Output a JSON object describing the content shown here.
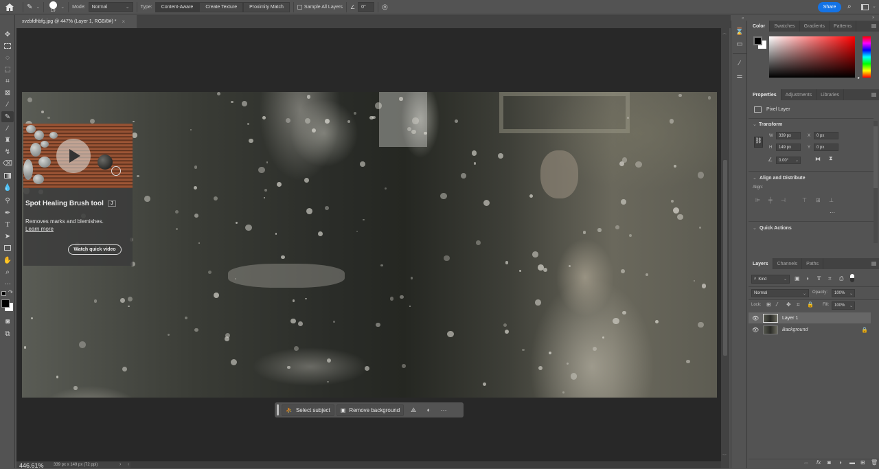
{
  "options_bar": {
    "home_icon": "home-icon",
    "tool_preset_icon": "spot-healing-brush-icon",
    "brush_size": "19",
    "mode_label": "Mode:",
    "mode_value": "Normal",
    "type_label": "Type:",
    "type_buttons": [
      {
        "label": "Content-Aware",
        "active": true
      },
      {
        "label": "Create Texture",
        "active": false
      },
      {
        "label": "Proximity Match",
        "active": false
      }
    ],
    "sample_all_layers": "Sample All Layers",
    "angle_value": "0°",
    "share_label": "Share",
    "accent_color": "#1473e6"
  },
  "document": {
    "tab_title": "xvzbfdhbfg.jpg @ 447% (Layer 1, RGB/8#) *",
    "zoom": "446.61%",
    "info": "339 px x 149 px (72 ppi)"
  },
  "tooltip": {
    "title": "Spot Healing Brush tool",
    "shortcut": "J",
    "description": "Removes marks and blemishes.",
    "learn_more": "Learn more",
    "video_button": "Watch quick video"
  },
  "taskbar": {
    "select_subject": "Select subject",
    "remove_background": "Remove background"
  },
  "color_panel": {
    "tabs": [
      "Color",
      "Swatches",
      "Gradients",
      "Patterns"
    ],
    "active_tab": "Color",
    "foreground": "#000000",
    "background": "#ffffff",
    "hue_color": "#ff0000"
  },
  "properties_panel": {
    "tabs": [
      "Properties",
      "Adjustments",
      "Libraries"
    ],
    "layer_type": "Pixel Layer",
    "transform_title": "Transform",
    "w_label": "W",
    "w_value": "339 px",
    "h_label": "H",
    "h_value": "149 px",
    "x_label": "X",
    "x_value": "0 px",
    "y_label": "Y",
    "y_value": "0 px",
    "angle_value": "0.00°",
    "align_title": "Align and Distribute",
    "align_label": "Align:",
    "quick_actions_title": "Quick Actions"
  },
  "layers_panel": {
    "tabs": [
      "Layers",
      "Channels",
      "Paths"
    ],
    "filter_kind": "Kind",
    "blend_mode": "Normal",
    "opacity_label": "Opacity:",
    "opacity_value": "100%",
    "lock_label": "Lock:",
    "fill_label": "Fill:",
    "fill_value": "100%",
    "layers": [
      {
        "name": "Layer 1",
        "selected": true,
        "visible": true,
        "locked": false
      },
      {
        "name": "Background",
        "selected": false,
        "visible": true,
        "locked": true
      }
    ]
  }
}
